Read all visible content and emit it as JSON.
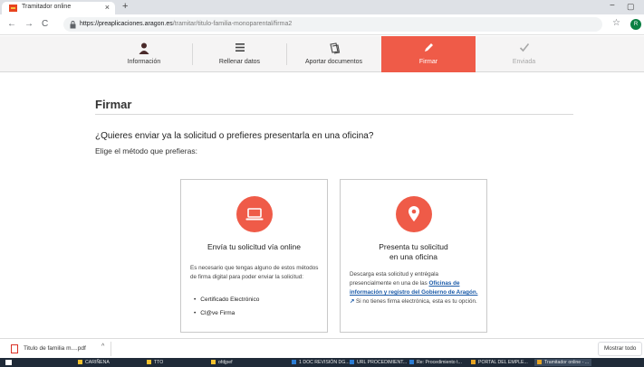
{
  "browser": {
    "tab_title": "Tramitador online",
    "tab_close": "×",
    "new_tab": "+",
    "minimize": "−",
    "maximize": "▢",
    "url_host": "https://preaplicaciones.aragon.es",
    "url_path": "/tramitar/titulo-familia-monoparental/firma2",
    "nav": {
      "back": "←",
      "forward": "→",
      "reload": "C"
    },
    "star": "☆",
    "avatar_letter": "R"
  },
  "steps": [
    {
      "label": "Información",
      "icon": "person-icon"
    },
    {
      "label": "Rellenar datos",
      "icon": "list-icon"
    },
    {
      "label": "Aportar documentos",
      "icon": "documents-icon"
    },
    {
      "label": "Firmar",
      "icon": "pen-icon"
    },
    {
      "label": "Enviada",
      "icon": "check-icon"
    }
  ],
  "page": {
    "title": "Firmar",
    "question": "¿Quieres enviar ya la solicitud o prefieres presentarla en una oficina?",
    "choose": "Elige el método que prefieras:"
  },
  "online_card": {
    "title": "Envía tu solicitud vía online",
    "text": "Es necesario que tengas alguno de estos métodos de firma digital para poder enviar la solicitud:",
    "methods": [
      "Certificado Electrónico",
      "Cl@ve Firma"
    ]
  },
  "office_card": {
    "title_line1": "Presenta tu solicitud",
    "title_line2": "en una oficina",
    "text_before": "Descarga esta solicitud y entrégala presencialmente en una de las",
    "link_text": "Oficinas de información y registro del Gobierno de Aragón.",
    "text_after": "Si no tienes firma electrónica, esta es tu opción."
  },
  "downloads": {
    "file_name": "Titulo de familia m....pdf",
    "chevron": "^",
    "show_all": "Mostrar todo"
  },
  "taskbar": {
    "items": [
      {
        "label": "CARIÑENA",
        "color": "#f2c12e"
      },
      {
        "label": "TTO",
        "color": "#f2c12e"
      },
      {
        "label": "ofdjpef",
        "color": "#f2c12e"
      },
      {
        "label": "1 DOC REVISIÓN DG...",
        "color": "#2b7cd3"
      },
      {
        "label": "URL PROCEDIMIENT...",
        "color": "#2b7cd3"
      },
      {
        "label": "Re: Procedimiento t...",
        "color": "#2b7cd3"
      },
      {
        "label": "PORTAL DEL EMPLE...",
        "color": "#e5a323"
      },
      {
        "label": "Tramitador online - ...",
        "color": "#e5a323"
      }
    ]
  }
}
